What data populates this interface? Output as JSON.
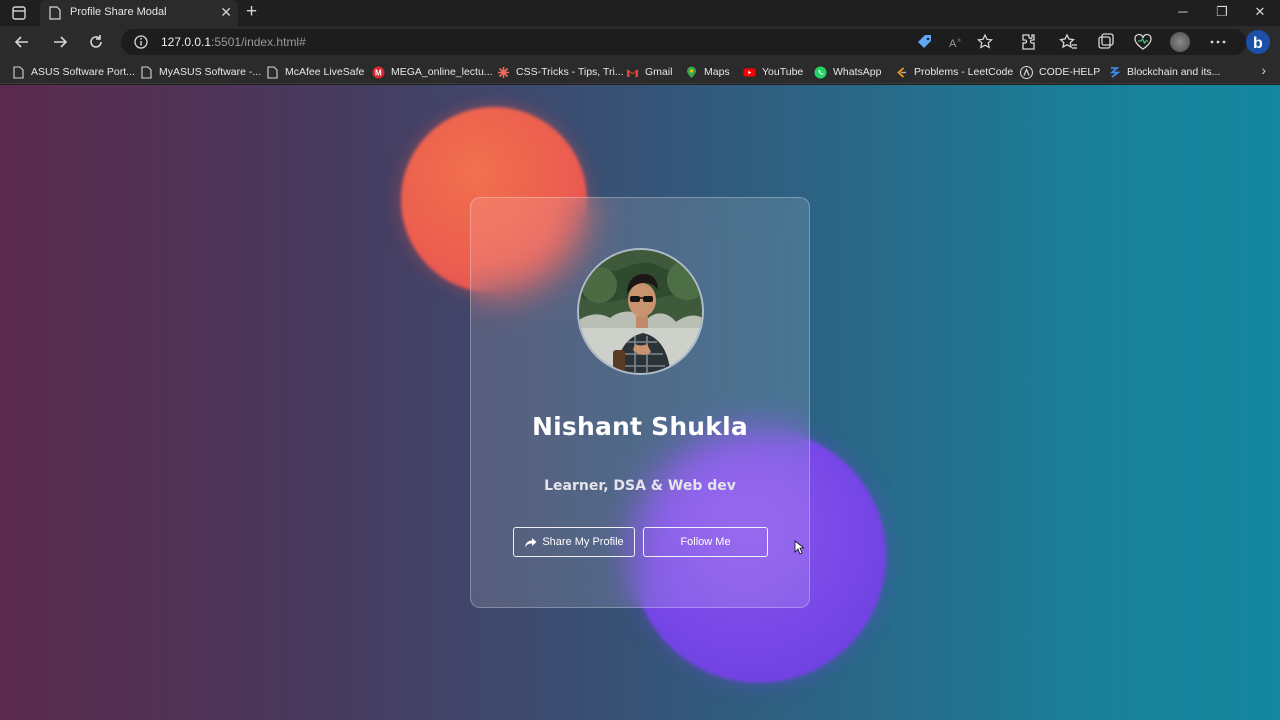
{
  "browser": {
    "tab": {
      "title": "Profile Share Modal"
    },
    "address": {
      "host": "127.0.0.1",
      "path": ":5501/index.html#"
    },
    "bookmarks": [
      {
        "label": "ASUS Software Port...",
        "icon": "page-icon"
      },
      {
        "label": "MyASUS Software -...",
        "icon": "page-icon"
      },
      {
        "label": "McAfee LiveSafe",
        "icon": "page-icon"
      },
      {
        "label": "MEGA_online_lectu...",
        "icon": "mega-icon"
      },
      {
        "label": "CSS-Tricks - Tips, Tri...",
        "icon": "css-tricks-icon"
      },
      {
        "label": "Gmail",
        "icon": "gmail-icon"
      },
      {
        "label": "Maps",
        "icon": "maps-icon"
      },
      {
        "label": "YouTube",
        "icon": "youtube-icon"
      },
      {
        "label": "WhatsApp",
        "icon": "whatsapp-icon"
      },
      {
        "label": "Problems - LeetCode",
        "icon": "leetcode-icon"
      },
      {
        "label": "CODE-HELP",
        "icon": "codehelp-icon"
      },
      {
        "label": "Blockchain and its...",
        "icon": "blockchain-icon"
      }
    ]
  },
  "profile": {
    "name": "Nishant Shukla",
    "bio": "Learner, DSA & Web dev",
    "share_label": "Share My Profile",
    "follow_label": "Follow Me"
  },
  "colors": {
    "orange_blob": "#ec5e4f",
    "purple_blob": "#7545e6",
    "bg_left": "#5b2a4c",
    "bg_right": "#12879e"
  }
}
